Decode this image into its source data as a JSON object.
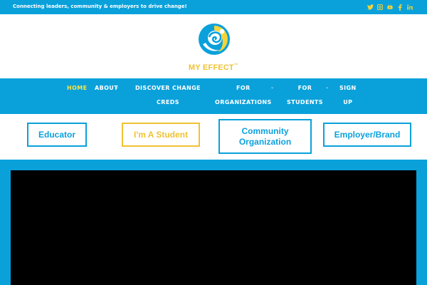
{
  "topbar": {
    "tagline": "Connecting leaders, community & employers to drive change!",
    "social_icons": [
      "twitter-icon",
      "instagram-icon",
      "youtube-icon",
      "facebook-icon",
      "linkedin-icon"
    ]
  },
  "brand": {
    "name": "MY EFFECT",
    "tm": "™"
  },
  "nav": {
    "home": "HOME",
    "about": "ABOUT",
    "discover_line1": "DISCOVER CHANGE",
    "discover_line2": "CREDS",
    "for_org_line1": "FOR",
    "for_org_line2": "ORGANIZATIONS",
    "for_students_line1": "FOR",
    "for_students_line2": "STUDENTS",
    "signup_line1": "SIGN",
    "signup_line2": "UP",
    "caret": "⌄"
  },
  "cta": {
    "educator": "Educator",
    "student": "I'm A Student",
    "community_line1": "Community",
    "community_line2": "Organization",
    "employer": "Employer/Brand"
  },
  "colors": {
    "brand_blue": "#0aa1db",
    "brand_yellow": "#f0c232",
    "active_nav": "#f6e54a"
  }
}
